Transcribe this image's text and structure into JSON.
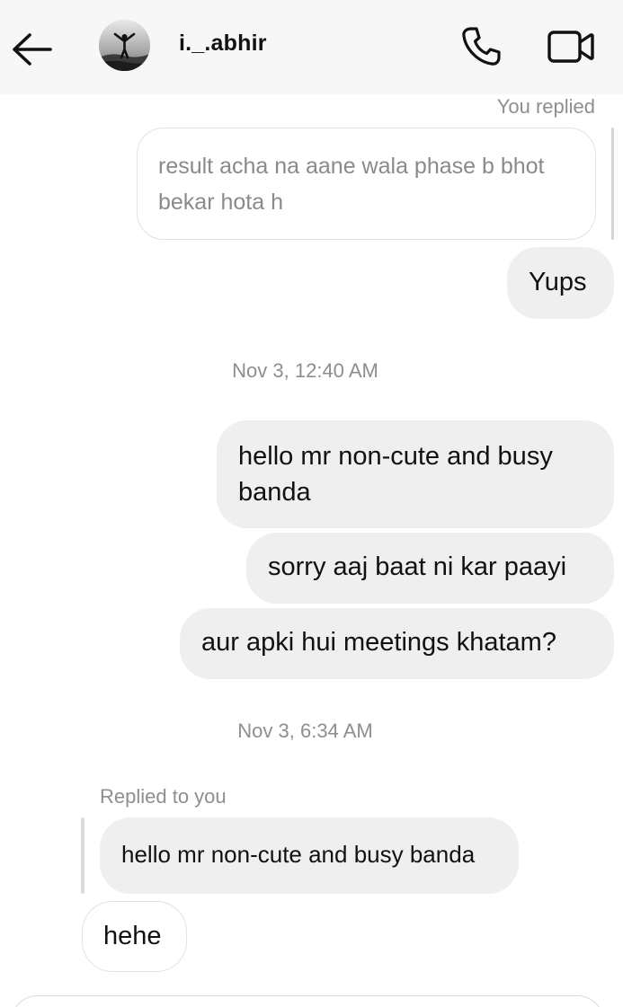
{
  "header": {
    "username": "i._.abhir",
    "back_icon": "arrow-left-icon",
    "call_icon": "phone-icon",
    "video_icon": "video-camera-icon"
  },
  "thread": {
    "you_replied_label": "You replied",
    "quoted_outgoing": "result acha na aane wala phase b bhot bekar hota h",
    "msg_yups": "Yups",
    "timestamp_1": "Nov 3, 12:40 AM",
    "msg_1": "hello mr non-cute and busy banda",
    "msg_2": "sorry aaj baat ni kar paayi",
    "msg_3": "aur apki hui meetings khatam?",
    "timestamp_2": "Nov 3, 6:34 AM",
    "replied_to_you_label": "Replied to you",
    "quoted_incoming": "hello mr non-cute and busy banda",
    "msg_hehe": "hehe"
  },
  "colors": {
    "header_bg": "#f7f7f7",
    "bubble_bg": "#efefef",
    "meta_text": "#8e8e8e"
  }
}
